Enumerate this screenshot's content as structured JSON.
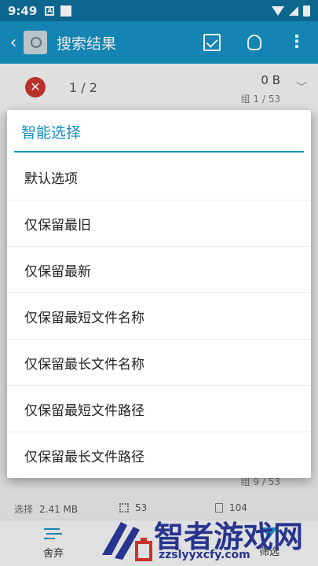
{
  "status_bar": {
    "time": "9:49",
    "badge": "A"
  },
  "app_bar": {
    "back": "‹",
    "title": "搜索结果",
    "more": "⋮"
  },
  "group": {
    "count": "1 / 2",
    "size": "0 B",
    "index": "组 1 / 53",
    "last_index": "组 9 / 53"
  },
  "dialog": {
    "title": "智能选择",
    "items": [
      {
        "label": "默认选项"
      },
      {
        "label": "仅保留最旧"
      },
      {
        "label": "仅保留最新"
      },
      {
        "label": "仅保留最短文件名称"
      },
      {
        "label": "仅保留最长文件名称"
      },
      {
        "label": "仅保留最短文件路径"
      },
      {
        "label": "仅保留最长文件路径"
      }
    ]
  },
  "summary": {
    "select_label": "选择",
    "size": "2.41 MB",
    "groups": "53",
    "files": "104"
  },
  "bottom_nav": {
    "discard": "舍弃",
    "filter": "筛选"
  },
  "watermark": {
    "main": "智者游戏网",
    "url": "zzslyyxcfy.com"
  },
  "colors": {
    "accent": "#1690c2",
    "status_bar": "#0f6f99",
    "danger": "#c8372d",
    "watermark": "#2b3a9c"
  }
}
